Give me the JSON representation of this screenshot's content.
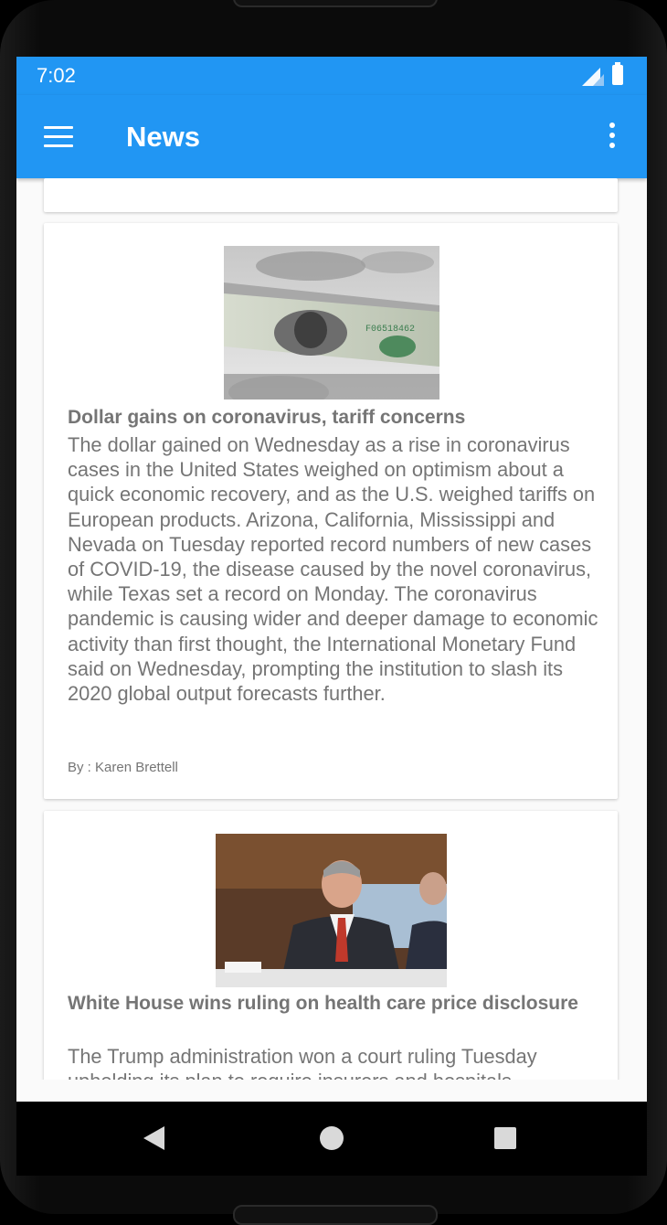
{
  "status_bar": {
    "time": "7:02"
  },
  "app_bar": {
    "title": "News"
  },
  "articles": [
    {
      "title": "Dollar gains on coronavirus, tariff concerns",
      "body": "The dollar gained on Wednesday as a rise in coronavirus cases in the United States weighed on optimism about a quick economic recovery, and as the U.S. weighed tariffs on European products.  Arizona, California, Mississippi and Nevada on Tuesday reported record numbers of new cases of COVID-19, the disease caused by the novel coronavirus, while Texas set a record on Monday.  The coronavirus pandemic is causing wider and deeper damage to economic activity than first thought, the International Monetary Fund said on Wednesday, prompting the institution to slash its 2020 global output forecasts further.",
      "author": "By : Karen Brettell"
    },
    {
      "title": "White House wins ruling on health care price disclosure",
      "body": "The Trump administration won a court ruling Tuesday upholding its plan to require insurers and hospitals"
    }
  ]
}
